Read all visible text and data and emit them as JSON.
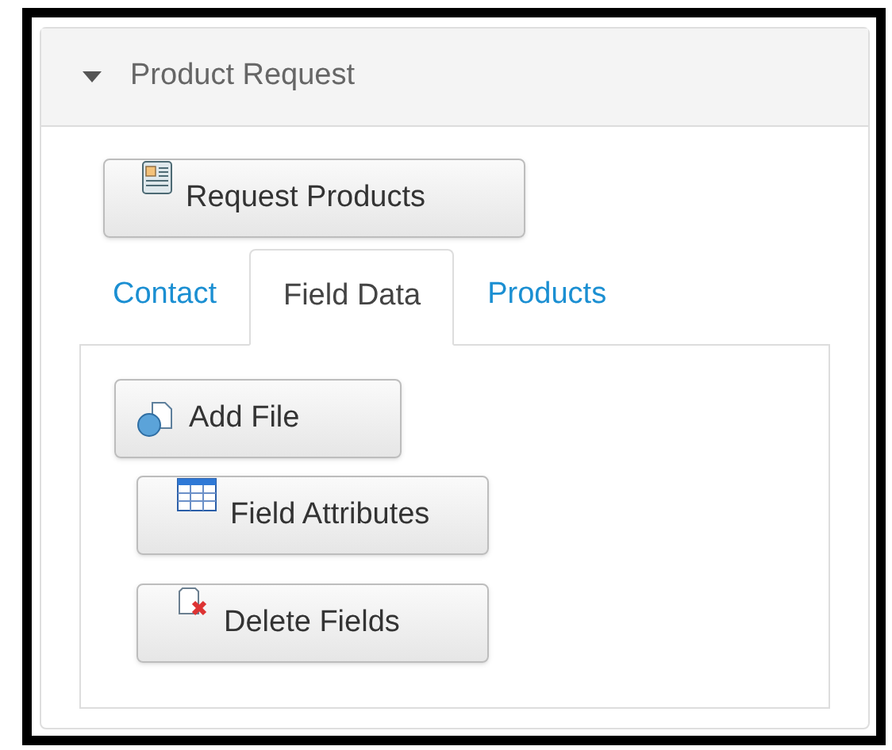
{
  "panel": {
    "title": "Product Request",
    "expanded": true
  },
  "top_button": {
    "label": "Request Products",
    "kind": "form"
  },
  "tabs": [
    {
      "label": "Contact",
      "selected": false
    },
    {
      "label": "Field Data",
      "selected": true
    },
    {
      "label": "Products",
      "selected": false
    }
  ],
  "buttons": [
    {
      "label": "Add File",
      "kind": "file"
    },
    {
      "label": "Field Attributes",
      "kind": "table"
    },
    {
      "label": "Delete Fields",
      "kind": "delete"
    }
  ]
}
